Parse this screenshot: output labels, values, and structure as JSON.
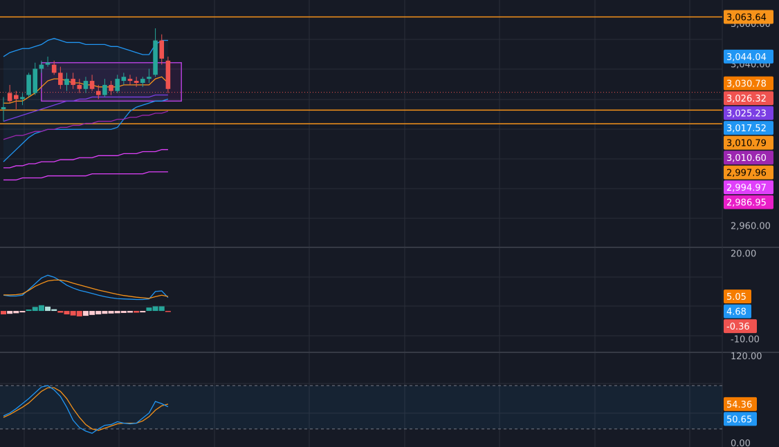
{
  "colors": {
    "background": "#161a25",
    "grid": "#2a2e39",
    "up": "#26a69a",
    "down": "#ef5350",
    "orange": "#f7931a",
    "blue": "#2196f3",
    "purple": "#7b3fe4",
    "violet": "#9c27b0",
    "magenta": "#e040fb",
    "axis_text": "#b2b5be"
  },
  "chart_data": [
    {
      "type": "candlestick",
      "panel": "price",
      "axis_ticks": [
        "3,060.00",
        "3,040.00",
        "2,960.00"
      ],
      "ylim": [
        2950,
        3072
      ],
      "horizontal_lines": [
        3063.64,
        3017.52,
        3010.79
      ],
      "candles": [
        {
          "o": 3018,
          "h": 3024,
          "l": 3012,
          "c": 3019
        },
        {
          "o": 3026,
          "h": 3030,
          "l": 3021,
          "c": 3022
        },
        {
          "o": 3025,
          "h": 3027,
          "l": 3018,
          "c": 3023
        },
        {
          "o": 3023,
          "h": 3026,
          "l": 3020,
          "c": 3024
        },
        {
          "o": 3025,
          "h": 3036,
          "l": 3024,
          "c": 3035
        },
        {
          "o": 3026,
          "h": 3041,
          "l": 3025,
          "c": 3038
        },
        {
          "o": 3038,
          "h": 3042,
          "l": 3036,
          "c": 3040
        },
        {
          "o": 3040,
          "h": 3044,
          "l": 3039,
          "c": 3041
        },
        {
          "o": 3040,
          "h": 3042,
          "l": 3035,
          "c": 3036
        },
        {
          "o": 3036,
          "h": 3039,
          "l": 3028,
          "c": 3030
        },
        {
          "o": 3030,
          "h": 3036,
          "l": 3027,
          "c": 3033
        },
        {
          "o": 3033,
          "h": 3036,
          "l": 3028,
          "c": 3030
        },
        {
          "o": 3030,
          "h": 3033,
          "l": 3026,
          "c": 3028
        },
        {
          "o": 3028,
          "h": 3034,
          "l": 3026,
          "c": 3032
        },
        {
          "o": 3032,
          "h": 3035,
          "l": 3027,
          "c": 3028
        },
        {
          "o": 3027,
          "h": 3030,
          "l": 3023,
          "c": 3025
        },
        {
          "o": 3025,
          "h": 3033,
          "l": 3024,
          "c": 3030
        },
        {
          "o": 3030,
          "h": 3032,
          "l": 3025,
          "c": 3027
        },
        {
          "o": 3027,
          "h": 3035,
          "l": 3026,
          "c": 3033
        },
        {
          "o": 3032,
          "h": 3036,
          "l": 3030,
          "c": 3034
        },
        {
          "o": 3033,
          "h": 3035,
          "l": 3030,
          "c": 3032
        },
        {
          "o": 3032,
          "h": 3034,
          "l": 3029,
          "c": 3031
        },
        {
          "o": 3031,
          "h": 3034,
          "l": 3029,
          "c": 3033
        },
        {
          "o": 3033,
          "h": 3038,
          "l": 3031,
          "c": 3034
        },
        {
          "o": 3035,
          "h": 3058,
          "l": 3034,
          "c": 3052
        },
        {
          "o": 3052,
          "h": 3055,
          "l": 3040,
          "c": 3043
        },
        {
          "o": 3042,
          "h": 3044,
          "l": 3026,
          "c": 3028
        }
      ],
      "lines": [
        {
          "name": "upper",
          "color": "#2196f3",
          "values": [
            3044,
            3046,
            3047,
            3048,
            3048,
            3049,
            3050,
            3052,
            3053,
            3052,
            3051,
            3051,
            3051,
            3050,
            3050,
            3050,
            3050,
            3049,
            3049,
            3048,
            3047,
            3046,
            3045,
            3045,
            3050,
            3052,
            3052
          ]
        },
        {
          "name": "lower",
          "color": "#2196f3",
          "values": [
            2992,
            2995,
            2998,
            3001,
            3004,
            3006,
            3007,
            3008,
            3008,
            3008,
            3008,
            3008,
            3008,
            3008,
            3008,
            3008,
            3008,
            3008,
            3009,
            3013,
            3017,
            3019,
            3020,
            3021,
            3022,
            3022,
            3023
          ]
        },
        {
          "name": "ma-fast",
          "color": "#f7931a",
          "values": [
            3021,
            3021,
            3022,
            3022,
            3024,
            3026,
            3029,
            3032,
            3033,
            3033,
            3032,
            3031,
            3031,
            3030,
            3030,
            3029,
            3029,
            3029,
            3029,
            3030,
            3030,
            3030,
            3030,
            3030,
            3033,
            3034,
            3031
          ]
        },
        {
          "name": "ma-mid",
          "color": "#7b3fe4",
          "values": [
            3012,
            3013,
            3014,
            3015,
            3016,
            3017,
            3018,
            3019,
            3020,
            3021,
            3022,
            3022,
            3023,
            3023,
            3024,
            3024,
            3024,
            3024,
            3024,
            3024,
            3024,
            3024,
            3024,
            3024,
            3025,
            3025,
            3025
          ]
        },
        {
          "name": "ma-slow",
          "color": "#9c27b0",
          "values": [
            3003,
            3004,
            3005,
            3005,
            3006,
            3007,
            3007,
            3008,
            3008,
            3009,
            3009,
            3010,
            3010,
            3011,
            3011,
            3012,
            3012,
            3012,
            3013,
            3013,
            3014,
            3014,
            3015,
            3015,
            3016,
            3016,
            3017
          ]
        },
        {
          "name": "ma-long1",
          "color": "#e040fb",
          "values": [
            2989,
            2989,
            2990,
            2990,
            2991,
            2991,
            2992,
            2992,
            2992,
            2993,
            2993,
            2993,
            2994,
            2994,
            2994,
            2995,
            2995,
            2995,
            2995,
            2996,
            2996,
            2996,
            2997,
            2997,
            2997,
            2998,
            2998
          ]
        },
        {
          "name": "ma-long2",
          "color": "#e040fb",
          "values": [
            2983,
            2983,
            2983,
            2984,
            2984,
            2984,
            2984,
            2985,
            2985,
            2985,
            2985,
            2985,
            2985,
            2985,
            2986,
            2986,
            2986,
            2986,
            2986,
            2986,
            2986,
            2986,
            2986,
            2987,
            2987,
            2987,
            2987
          ]
        }
      ],
      "price_labels": [
        {
          "text": "3,063.64",
          "value": 3063.64,
          "bg": "#f7931a",
          "fg": "#000000"
        },
        {
          "text": "3,044.04",
          "value": 3044.04,
          "bg": "#2196f3",
          "fg": "#ffffff"
        },
        {
          "text": "3,030.78",
          "value": 3030.78,
          "bg": "#f57c00",
          "fg": "#ffffff"
        },
        {
          "text": "3,026.32",
          "value": 3026.32,
          "bg": "#ef5350",
          "fg": "#ffffff"
        },
        {
          "text": "3,025.23",
          "value": 3025.23,
          "bg": "#7b3fe4",
          "fg": "#ffffff"
        },
        {
          "text": "3,017.52",
          "value": 3017.52,
          "bg": "#2196f3",
          "fg": "#ffffff"
        },
        {
          "text": "3,010.79",
          "value": 3010.79,
          "bg": "#f7931a",
          "fg": "#000000"
        },
        {
          "text": "3,010.60",
          "value": 3010.6,
          "bg": "#9c27b0",
          "fg": "#ffffff"
        },
        {
          "text": "2,997.96",
          "value": 2997.96,
          "bg": "#f7931a",
          "fg": "#000000"
        },
        {
          "text": "2,994.97",
          "value": 2994.97,
          "bg": "#e040fb",
          "fg": "#ffffff"
        },
        {
          "text": "2,986.95",
          "value": 2986.95,
          "bg": "#e91ec8",
          "fg": "#ffffff"
        }
      ]
    },
    {
      "type": "macd",
      "panel": "macd",
      "axis_ticks": [
        "20.00",
        "-10.00"
      ],
      "ylim": [
        -14,
        22
      ],
      "histogram": [
        -1.2,
        -1.0,
        -0.8,
        -0.5,
        0.5,
        1.4,
        2.0,
        1.5,
        0.6,
        -0.6,
        -1.2,
        -1.6,
        -1.9,
        -1.7,
        -1.4,
        -1.2,
        -1.0,
        -0.9,
        -0.8,
        -0.7,
        -0.6,
        -0.6,
        -0.5,
        1.2,
        1.6,
        1.6,
        -0.36
      ],
      "macd_line": [
        5.5,
        5.2,
        5.2,
        5.5,
        7.5,
        9.5,
        11.5,
        12.5,
        11.8,
        10.5,
        9.0,
        8.0,
        7.2,
        6.7,
        6.1,
        5.5,
        5.0,
        4.6,
        4.3,
        4.2,
        4.1,
        4.0,
        4.0,
        4.2,
        6.8,
        7.0,
        4.68
      ],
      "signal_line": [
        5.6,
        5.6,
        5.7,
        6.0,
        7.2,
        8.6,
        9.6,
        10.5,
        10.8,
        10.8,
        10.4,
        9.7,
        9.1,
        8.5,
        7.9,
        7.3,
        6.8,
        6.3,
        5.8,
        5.4,
        5.1,
        4.8,
        4.6,
        4.4,
        5.0,
        5.5,
        5.05
      ],
      "price_labels": [
        {
          "text": "5.05",
          "value": 5.05,
          "bg": "#f57c00",
          "fg": "#ffffff"
        },
        {
          "text": "4.68",
          "value": 4.68,
          "bg": "#2196f3",
          "fg": "#ffffff"
        },
        {
          "text": "-0.36",
          "value": -0.36,
          "bg": "#ef5350",
          "fg": "#ffffff"
        }
      ]
    },
    {
      "type": "line",
      "panel": "oscillator",
      "axis_ticks": [
        "120.00",
        "0.00"
      ],
      "ylim": [
        -5,
        125
      ],
      "band": [
        20,
        80
      ],
      "k_line": [
        38,
        42,
        48,
        55,
        62,
        70,
        78,
        80,
        74,
        65,
        50,
        32,
        22,
        17,
        14,
        20,
        25,
        26,
        30,
        28,
        27,
        28,
        35,
        42,
        58,
        55,
        50.65
      ],
      "d_line": [
        36,
        40,
        45,
        50,
        56,
        64,
        72,
        77,
        77,
        72,
        62,
        48,
        36,
        26,
        20,
        18,
        21,
        24,
        27,
        28,
        28,
        28,
        31,
        37,
        46,
        52,
        54.36
      ],
      "price_labels": [
        {
          "text": "54.36",
          "value": 54.36,
          "bg": "#f57c00",
          "fg": "#ffffff"
        },
        {
          "text": "50.65",
          "value": 50.65,
          "bg": "#2196f3",
          "fg": "#ffffff"
        }
      ]
    }
  ]
}
